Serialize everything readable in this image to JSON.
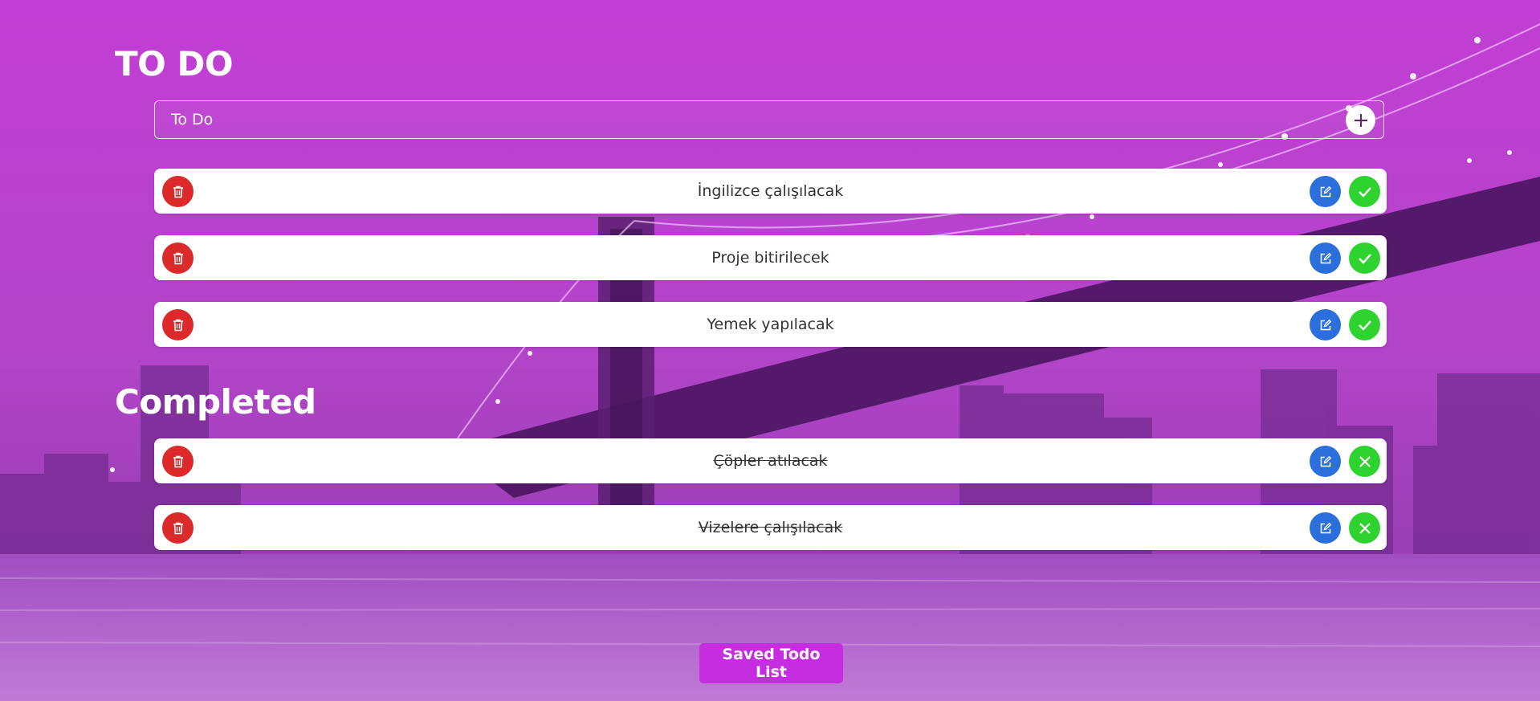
{
  "app": {
    "todo_heading": "TO DO",
    "completed_heading": "Completed"
  },
  "input": {
    "placeholder": "To Do",
    "value": ""
  },
  "todo_items": [
    {
      "label": "İngilizce çalışılacak"
    },
    {
      "label": "Proje bitirilecek"
    },
    {
      "label": "Yemek yapılacak"
    }
  ],
  "completed_items": [
    {
      "label": "Çöpler atılacak"
    },
    {
      "label": "Vizelere çalışılacak"
    }
  ],
  "footer": {
    "saved_button_label": "Saved Todo List"
  },
  "icons": {
    "add": "plus-icon",
    "delete": "trash-icon",
    "edit": "edit-icon",
    "complete": "check-icon",
    "uncomplete": "close-icon"
  },
  "colors": {
    "background": "#b83fcd",
    "delete": "#dc2a2a",
    "edit": "#2a6fdc",
    "complete": "#2fd32f",
    "saved_button": "#c72de0"
  }
}
